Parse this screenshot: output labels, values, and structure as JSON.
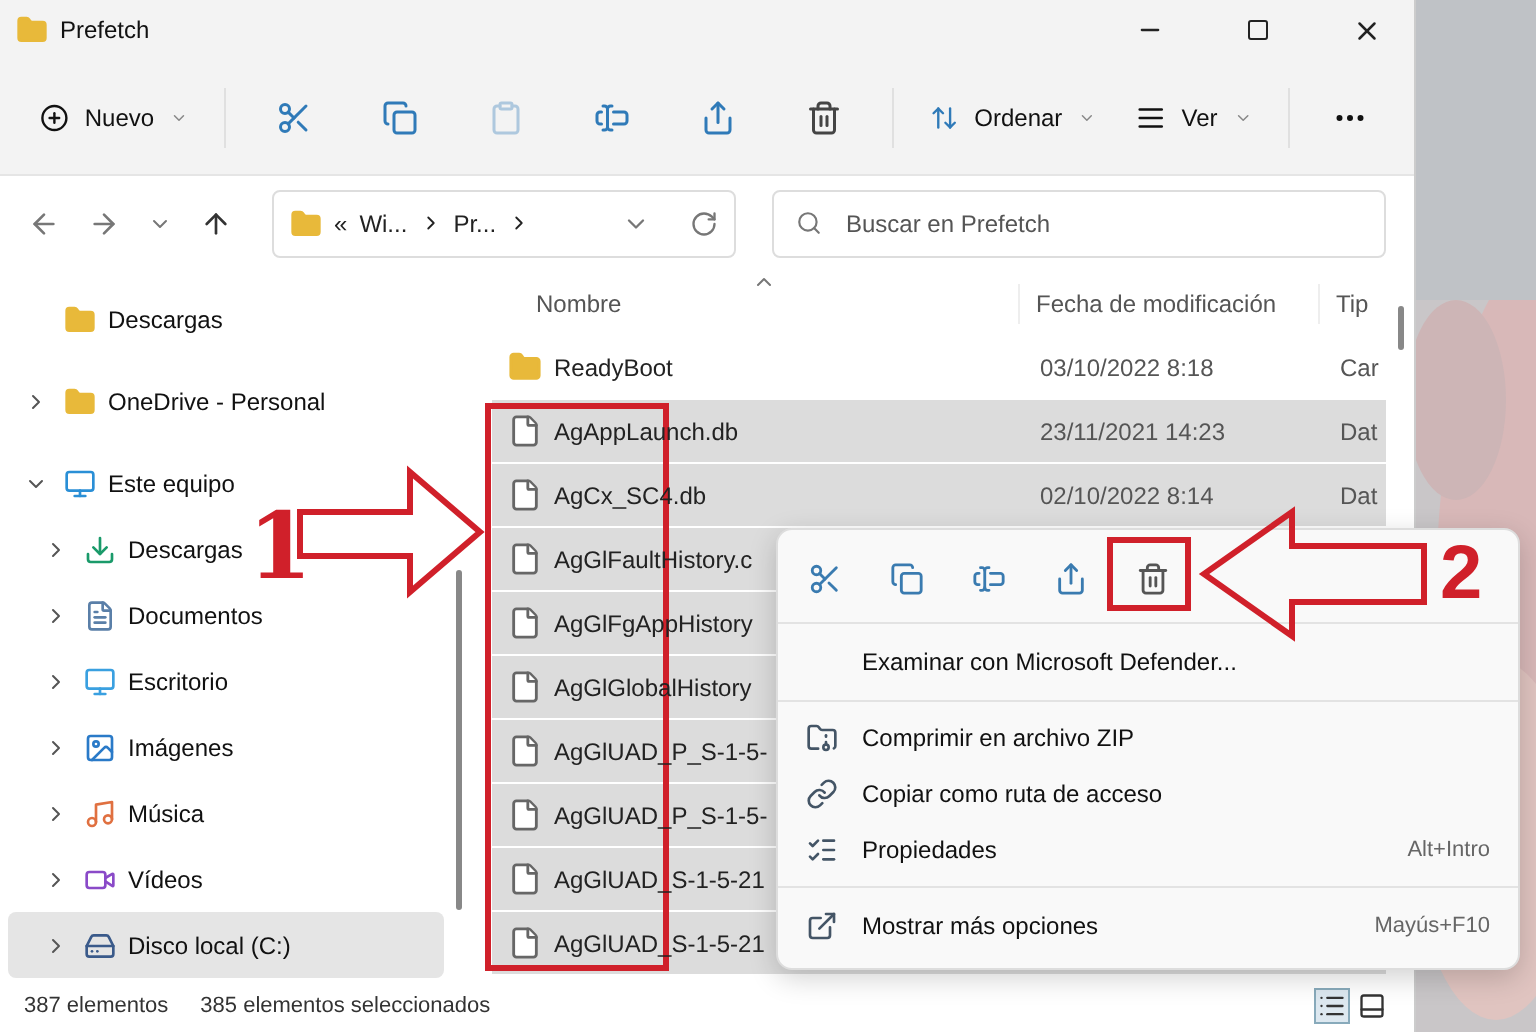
{
  "window": {
    "title": "Prefetch"
  },
  "toolbar": {
    "new_label": "Nuevo",
    "actions": [
      {
        "kind": "cut",
        "disabled": false
      },
      {
        "kind": "copy",
        "disabled": false
      },
      {
        "kind": "paste",
        "disabled": true
      },
      {
        "kind": "rename",
        "disabled": false
      },
      {
        "kind": "share",
        "disabled": false
      },
      {
        "kind": "delete",
        "disabled": false
      }
    ],
    "sort_label": "Ordenar",
    "view_label": "Ver"
  },
  "address": {
    "overflow_mark": "«",
    "segments": [
      "Wi...",
      "Pr..."
    ]
  },
  "search": {
    "placeholder": "Buscar en Prefetch"
  },
  "sidebar": {
    "items": [
      {
        "label": "Descargas",
        "selected": false
      },
      {
        "label": "OneDrive - Personal",
        "expanded": false,
        "selected": false
      },
      {
        "label": "Este equipo",
        "expanded": true,
        "selected": false,
        "children": [
          {
            "label": "Descargas",
            "expanded": false,
            "selected": false
          },
          {
            "label": "Documentos",
            "expanded": false,
            "selected": false
          },
          {
            "label": "Escritorio",
            "expanded": false,
            "selected": false
          },
          {
            "label": "Imágenes",
            "expanded": false,
            "selected": false
          },
          {
            "label": "Música",
            "expanded": false,
            "selected": false
          },
          {
            "label": "Vídeos",
            "expanded": false,
            "selected": false
          },
          {
            "label": "Disco local (C:)",
            "expanded": false,
            "selected": true
          }
        ]
      }
    ]
  },
  "file_list": {
    "columns": [
      "Nombre",
      "Fecha de modificación",
      "Tip"
    ],
    "rows": [
      {
        "kind": "folder",
        "name": "ReadyBoot",
        "date": "03/10/2022 8:18",
        "type": "Car",
        "selected": false
      },
      {
        "kind": "file",
        "name": "AgAppLaunch.db",
        "date": "23/11/2021 14:23",
        "type": "Dat",
        "selected": true
      },
      {
        "kind": "file",
        "name": "AgCx_SC4.db",
        "date": "02/10/2022 8:14",
        "type": "Dat",
        "selected": true
      },
      {
        "kind": "file",
        "name": "AgGlFaultHistory.c",
        "selected": true
      },
      {
        "kind": "file",
        "name": "AgGlFgAppHistory",
        "selected": true
      },
      {
        "kind": "file",
        "name": "AgGlGlobalHistory",
        "selected": true
      },
      {
        "kind": "file",
        "name": "AgGlUAD_P_S-1-5-",
        "selected": true
      },
      {
        "kind": "file",
        "name": "AgGlUAD_P_S-1-5-",
        "selected": true
      },
      {
        "kind": "file",
        "name": "AgGlUAD_S-1-5-21",
        "selected": true
      },
      {
        "kind": "file",
        "name": "AgGlUAD_S-1-5-21",
        "selected": true
      }
    ]
  },
  "context_menu": {
    "quick_actions": [
      {
        "kind": "cut"
      },
      {
        "kind": "copy"
      },
      {
        "kind": "rename"
      },
      {
        "kind": "share"
      },
      {
        "kind": "delete"
      }
    ],
    "groups": [
      [
        {
          "label": "Examinar con Microsoft Defender..."
        }
      ],
      [
        {
          "label": "Comprimir en archivo ZIP"
        },
        {
          "label": "Copiar como ruta de acceso"
        },
        {
          "label": "Propiedades",
          "shortcut": "Alt+Intro"
        }
      ],
      [
        {
          "label": "Mostrar más opciones",
          "shortcut": "Mayús+F10"
        }
      ]
    ]
  },
  "status_bar": {
    "count": "387 elementos",
    "selection": "385 elementos seleccionados",
    "views": [
      {
        "kind": "details",
        "selected": true
      },
      {
        "kind": "tiles",
        "selected": false
      }
    ]
  },
  "annotations": [
    {
      "label": "1"
    },
    {
      "label": "2"
    }
  ]
}
